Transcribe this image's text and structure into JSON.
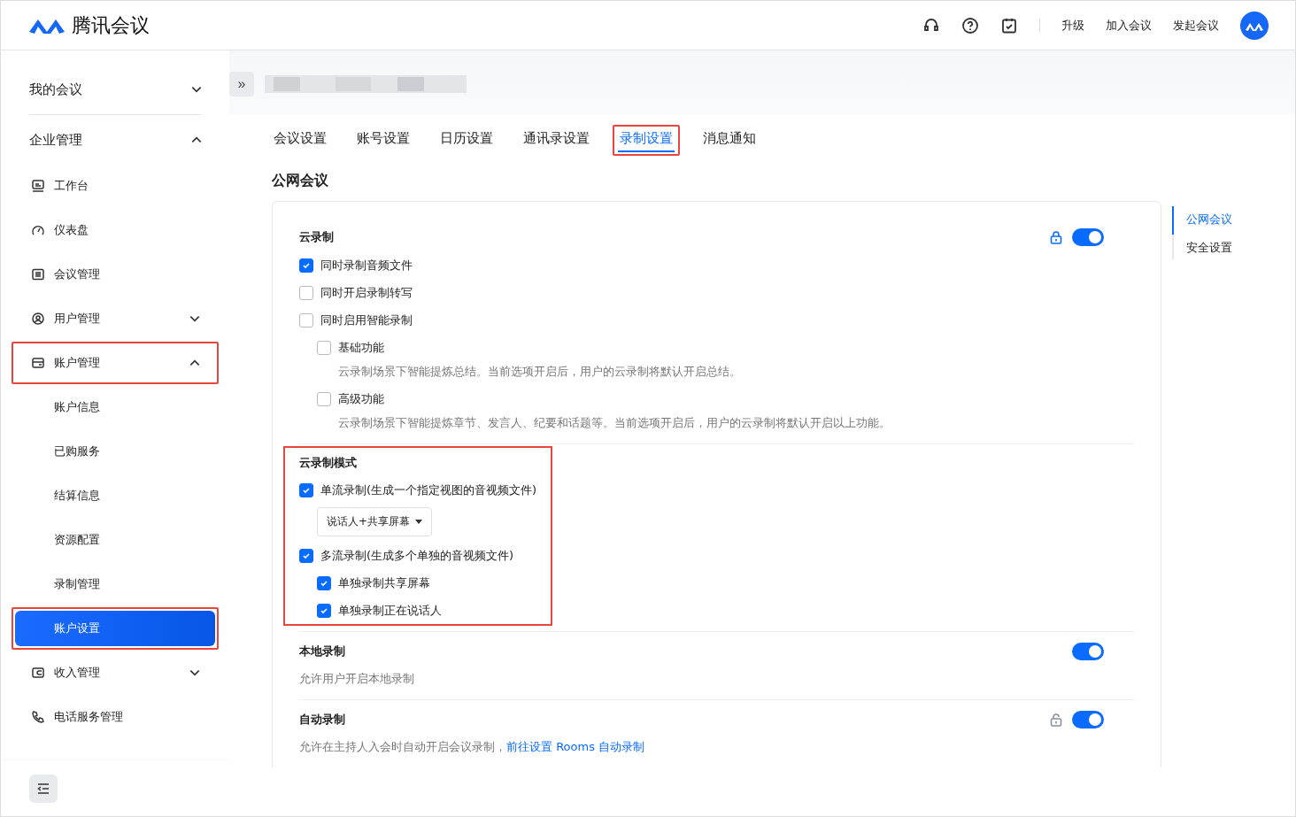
{
  "header": {
    "brand": "腾讯会议",
    "actions": [
      "升级",
      "加入会议",
      "发起会议"
    ]
  },
  "sidebar": {
    "groups": [
      {
        "label": "我的会议",
        "expanded": false
      },
      {
        "label": "企业管理",
        "expanded": true,
        "children": [
          {
            "label": "工作台",
            "selected": false,
            "highlighted": false
          },
          {
            "label": "仪表盘",
            "selected": false,
            "highlighted": false
          },
          {
            "label": "会议管理",
            "selected": false,
            "highlighted": false
          },
          {
            "label": "用户管理",
            "selected": false,
            "highlighted": false,
            "expanded": false
          },
          {
            "label": "账户管理",
            "selected": false,
            "highlighted": true,
            "expanded": true,
            "children": [
              {
                "label": "账户信息",
                "selected": false,
                "highlighted": false
              },
              {
                "label": "已购服务",
                "selected": false,
                "highlighted": false
              },
              {
                "label": "结算信息",
                "selected": false,
                "highlighted": false
              },
              {
                "label": "资源配置",
                "selected": false,
                "highlighted": false
              },
              {
                "label": "录制管理",
                "selected": false,
                "highlighted": false
              },
              {
                "label": "账户设置",
                "selected": true,
                "highlighted": true
              }
            ]
          },
          {
            "label": "收入管理",
            "selected": false,
            "highlighted": false,
            "expanded": false
          },
          {
            "label": "电话服务管理",
            "selected": false,
            "highlighted": false
          }
        ]
      }
    ]
  },
  "expand_button": "»",
  "tabs": [
    {
      "label": "会议设置",
      "selected": false,
      "highlighted": false
    },
    {
      "label": "账号设置",
      "selected": false,
      "highlighted": false
    },
    {
      "label": "日历设置",
      "selected": false,
      "highlighted": false
    },
    {
      "label": "通讯录设置",
      "selected": false,
      "highlighted": false
    },
    {
      "label": "录制设置",
      "selected": true,
      "highlighted": true
    },
    {
      "label": "消息通知",
      "selected": false,
      "highlighted": false
    }
  ],
  "heading": "公网会议",
  "sections": [
    {
      "title": "云录制",
      "highlighted": false,
      "locked": true,
      "toggle": true,
      "options": [
        {
          "kind": "checkbox",
          "label": "同时录制音频文件",
          "checked": true
        },
        {
          "kind": "checkbox",
          "label": "同时开启录制转写",
          "checked": false
        },
        {
          "kind": "checkbox",
          "label": "同时启用智能录制",
          "checked": false,
          "children": [
            {
              "kind": "checkbox",
              "label": "基础功能",
              "checked": false,
              "description": "云录制场景下智能提炼总结。当前选项开启后，用户的云录制将默认开启总结。"
            },
            {
              "kind": "checkbox",
              "label": "高级功能",
              "checked": false,
              "description": "云录制场景下智能提炼章节、发言人、纪要和话题等。当前选项开启后，用户的云录制将默认开启以上功能。"
            }
          ]
        }
      ]
    },
    {
      "title": "云录制模式",
      "highlighted": true,
      "options": [
        {
          "kind": "checkbox",
          "label": "单流录制(生成一个指定视图的音视频文件)",
          "checked": true,
          "children": [
            {
              "kind": "select",
              "value": "说话人+共享屏幕"
            }
          ]
        },
        {
          "kind": "checkbox",
          "label": "多流录制(生成多个单独的音视频文件)",
          "checked": true,
          "children": [
            {
              "kind": "checkbox",
              "label": "单独录制共享屏幕",
              "checked": true
            },
            {
              "kind": "checkbox",
              "label": "单独录制正在说话人",
              "checked": true
            }
          ]
        }
      ]
    },
    {
      "title": "本地录制",
      "highlighted": false,
      "toggle": true,
      "description": "允许用户开启本地录制"
    },
    {
      "title": "自动录制",
      "highlighted": false,
      "locked": false,
      "toggle": true,
      "description": "允许在主持人入会时自动开启会议录制，",
      "link": "前往设置 Rooms 自动录制"
    }
  ],
  "anchors": [
    {
      "label": "公网会议",
      "selected": true
    },
    {
      "label": "安全设置",
      "selected": false
    }
  ]
}
